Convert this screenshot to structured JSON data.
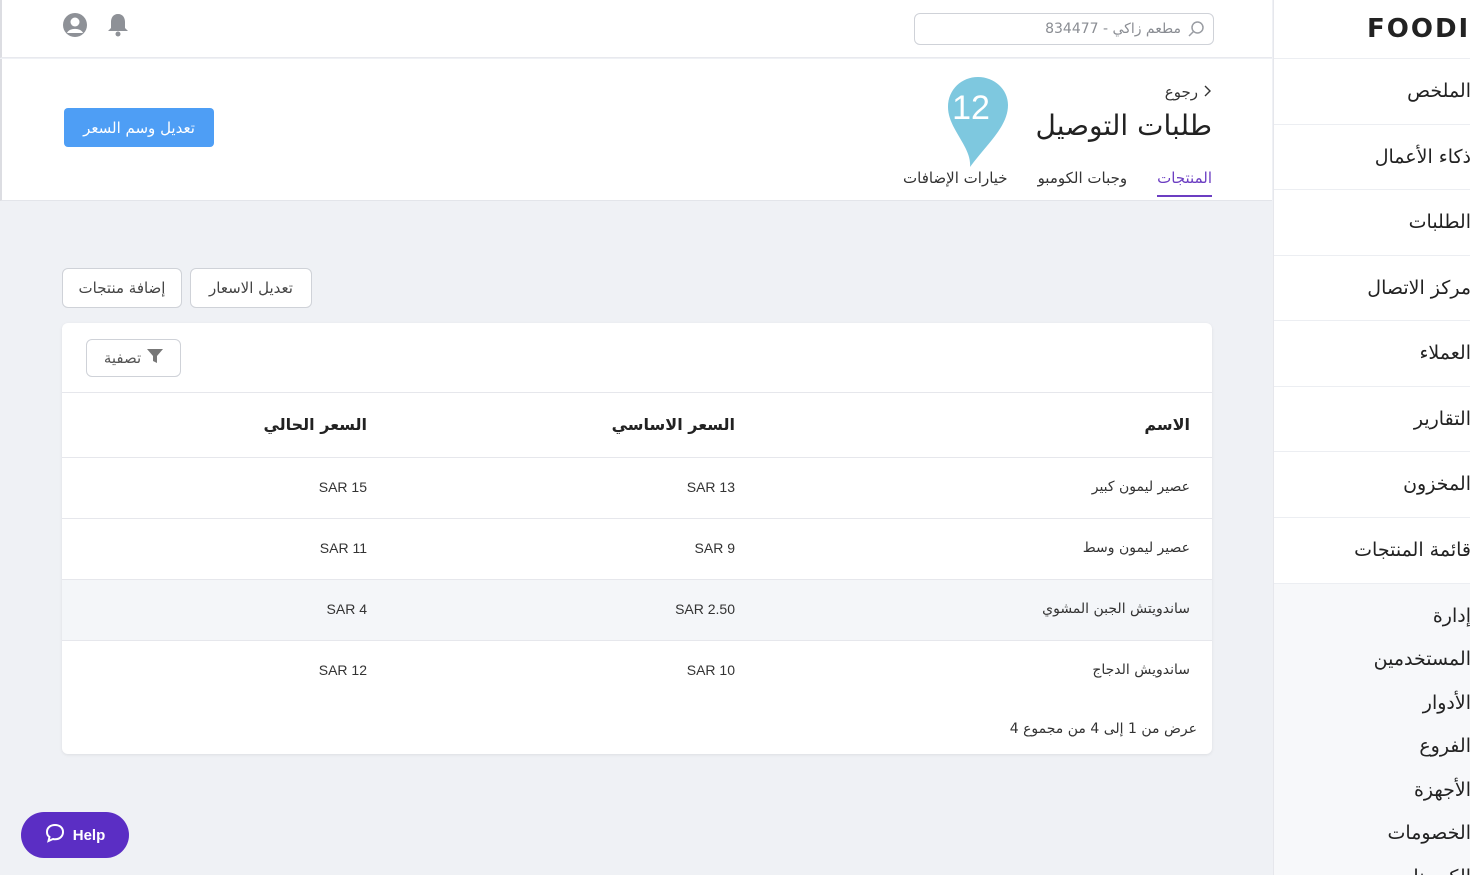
{
  "topbar": {
    "search_text": "مطعم زاكي - 834477"
  },
  "header": {
    "back_label": "رجوع",
    "title": "طلبات التوصيل",
    "badge_count": "12",
    "edit_tag_button": "تعديل وسم السعر",
    "tabs": [
      {
        "label": "المنتجات",
        "active": true
      },
      {
        "label": "وجبات الكومبو",
        "active": false
      },
      {
        "label": "خيارات الإضافات",
        "active": false
      }
    ]
  },
  "actions": {
    "edit_prices": "تعديل الاسعار",
    "add_products": "إضافة منتجات"
  },
  "table": {
    "filter_label": "تصفية",
    "columns": {
      "name": "الاسم",
      "base_price": "السعر الاساسي",
      "current_price": "السعر الحالي"
    },
    "rows": [
      {
        "name": "عصير ليمون كبير",
        "base_price": "SAR 13",
        "current_price": "SAR 15"
      },
      {
        "name": "عصير ليمون وسط",
        "base_price": "SAR 9",
        "current_price": "SAR 11"
      },
      {
        "name": "ساندويتش الجبن المشوي",
        "base_price": "SAR 2.50",
        "current_price": "SAR 4"
      },
      {
        "name": "ساندويش الدجاج",
        "base_price": "SAR 10",
        "current_price": "SAR 12"
      }
    ],
    "pagination": "عرض من 1 إلى 4 من مجموع 4"
  },
  "help": {
    "label": "Help"
  },
  "sidebar": {
    "logo": "FOODIC",
    "items": [
      {
        "label": "الملخص"
      },
      {
        "label": "ذكاء الأعمال"
      },
      {
        "label": "الطلبات"
      },
      {
        "label": "مركز الاتصال"
      },
      {
        "label": "العملاء"
      },
      {
        "label": "التقارير"
      },
      {
        "label": "المخزون"
      },
      {
        "label": "قائمة المنتجات"
      }
    ],
    "sub_items": [
      {
        "label": "إدارة"
      },
      {
        "label": "المستخدمين"
      },
      {
        "label": "الأدوار"
      },
      {
        "label": "الفروع"
      },
      {
        "label": "الأجهزة"
      },
      {
        "label": "الخصومات"
      },
      {
        "label": "الكوبونات"
      }
    ]
  },
  "colors": {
    "accent_purple": "#6c3ec2",
    "primary_blue": "#4e9ef5",
    "badge_teal": "#7ec8df",
    "help_purple": "#5b2ec4"
  }
}
